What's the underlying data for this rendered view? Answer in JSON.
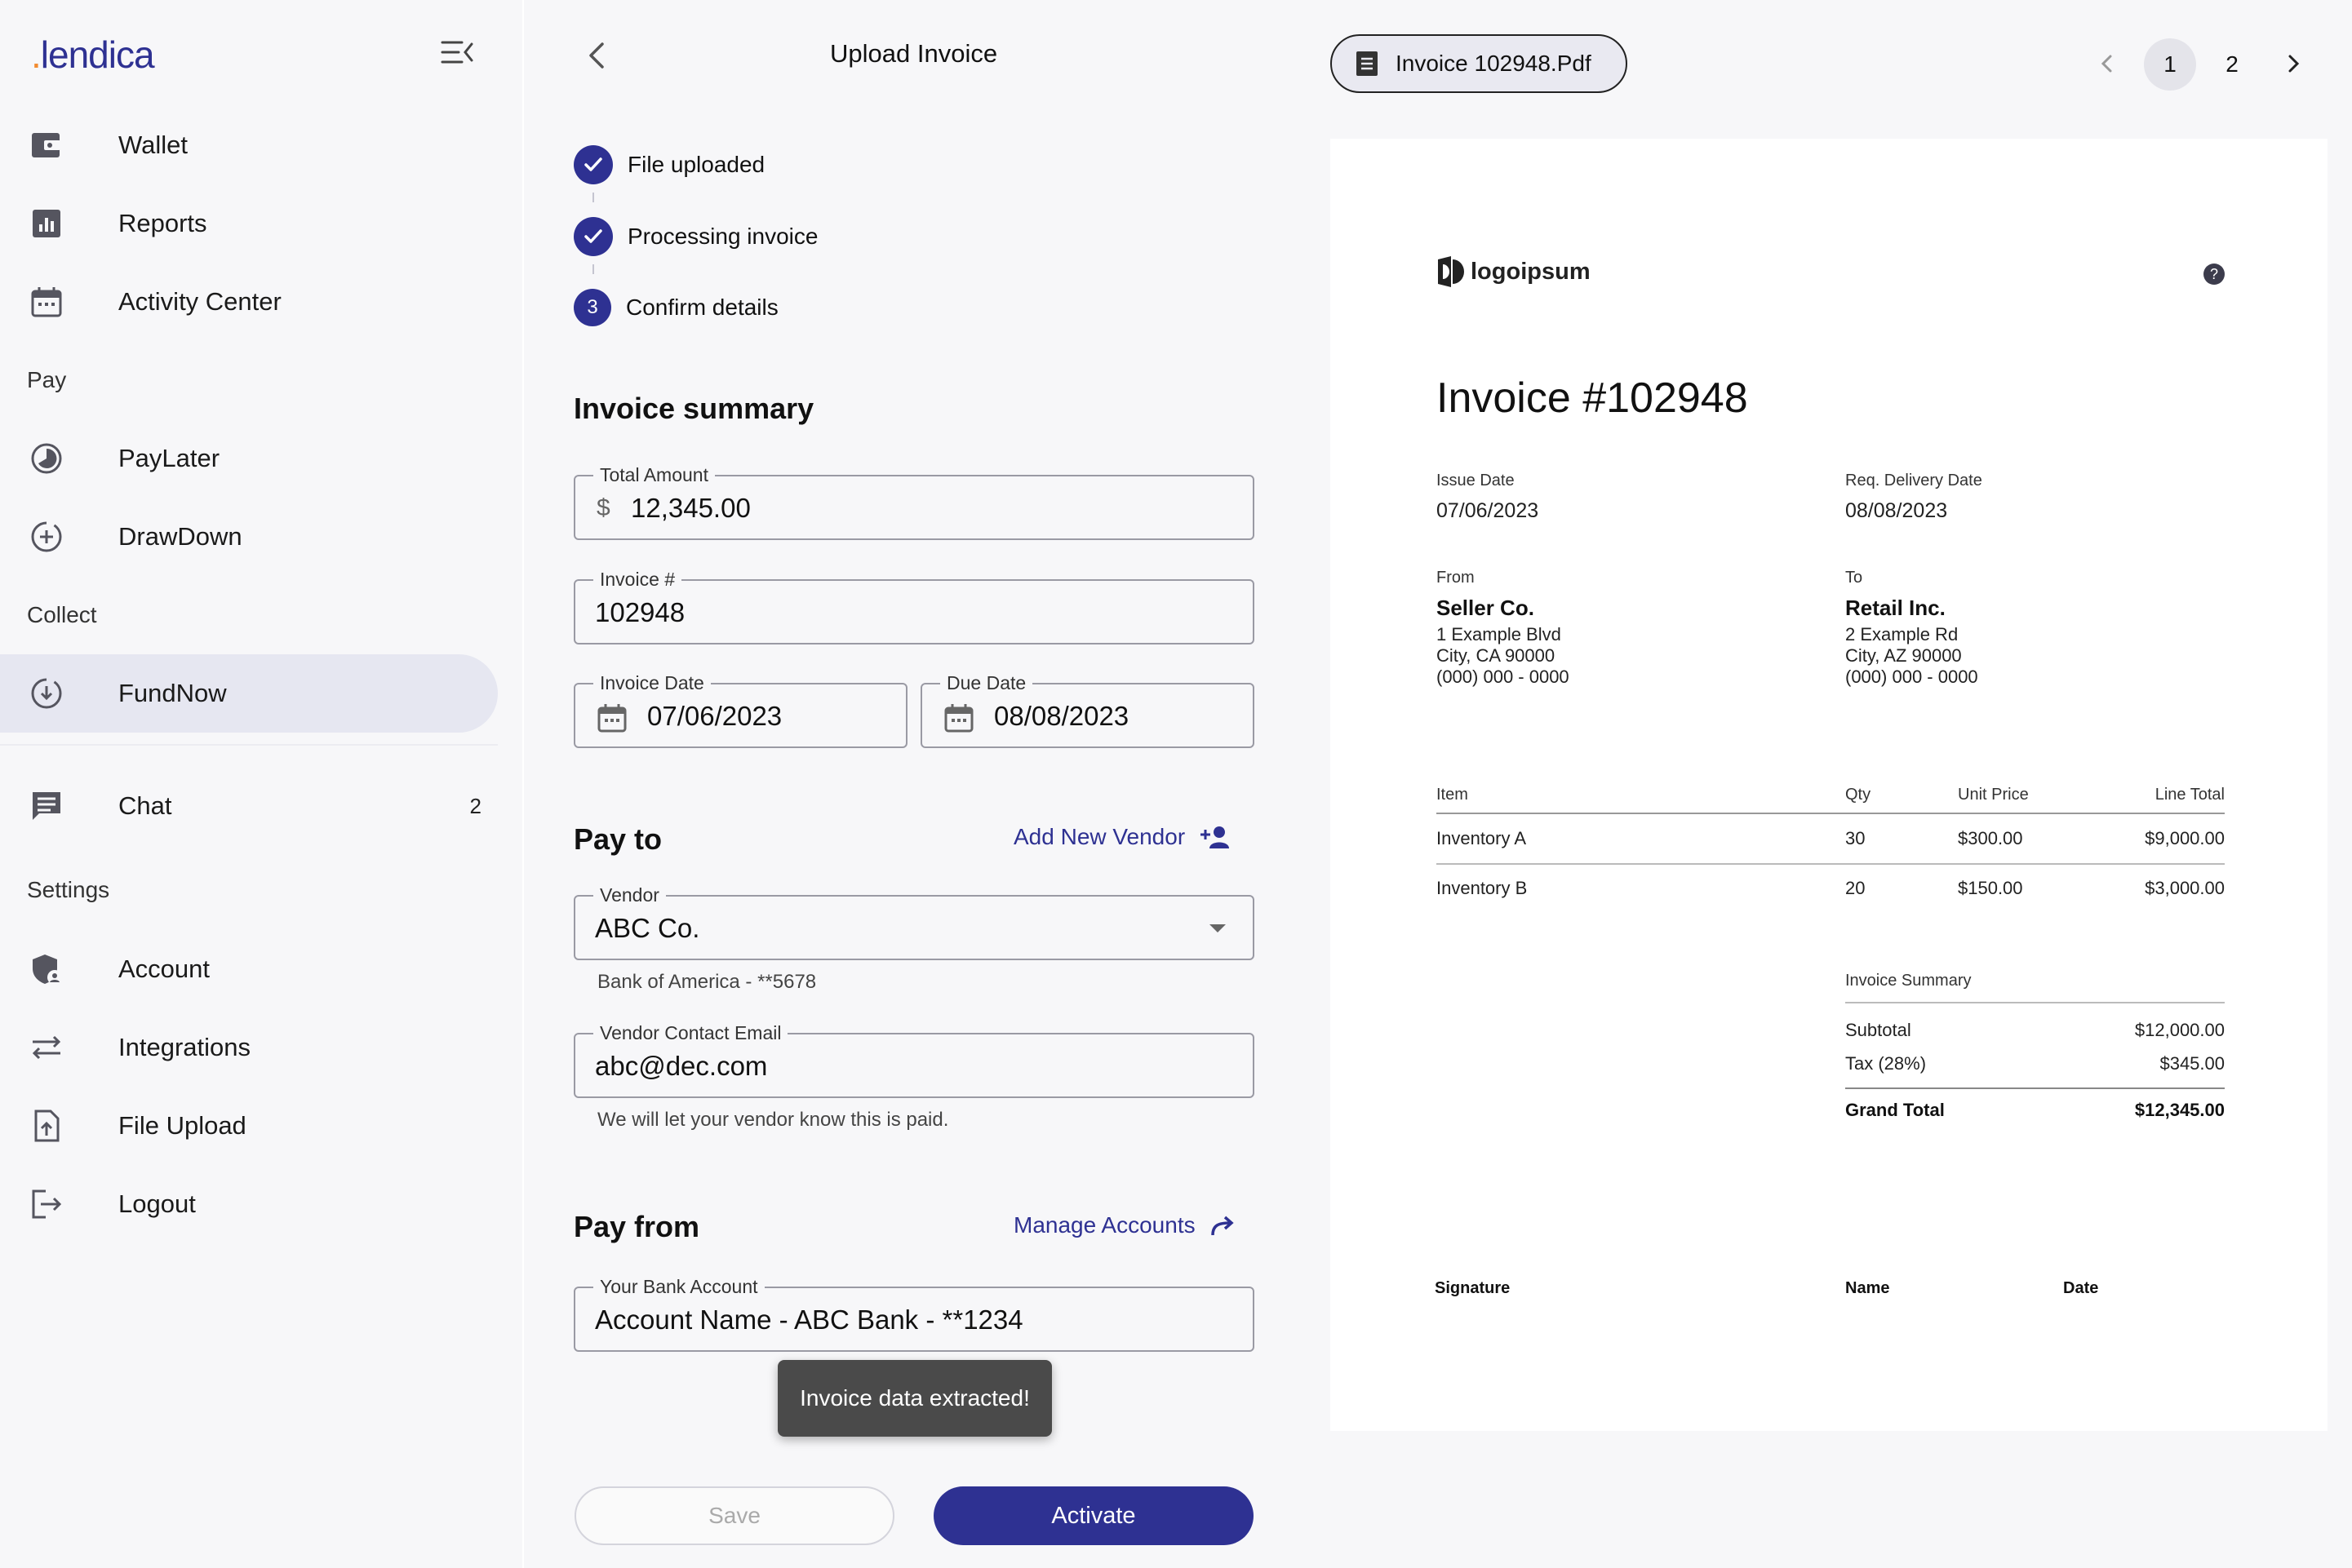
{
  "sidebar": {
    "logo_text": "lendica",
    "items": {
      "wallet": "Wallet",
      "reports": "Reports",
      "activity": "Activity Center",
      "paylater": "PayLater",
      "drawdown": "DrawDown",
      "fundnow": "FundNow",
      "chat": "Chat",
      "chat_badge": "2",
      "account": "Account",
      "integrations": "Integrations",
      "file_upload": "File Upload",
      "logout": "Logout"
    },
    "sections": {
      "pay": "Pay",
      "collect": "Collect",
      "settings": "Settings"
    }
  },
  "form": {
    "title": "Upload Invoice",
    "steps": [
      {
        "label": "File uploaded"
      },
      {
        "label": "Processing invoice"
      },
      {
        "label": "Confirm details",
        "number": "3"
      }
    ],
    "invoice_summary": {
      "heading": "Invoice summary",
      "total_amount_label": "Total Amount",
      "currency_symbol": "$",
      "total_amount": "12,345.00",
      "invoice_no_label": "Invoice #",
      "invoice_no": "102948",
      "invoice_date_label": "Invoice Date",
      "invoice_date": "07/06/2023",
      "due_date_label": "Due Date",
      "due_date": "08/08/2023"
    },
    "pay_to": {
      "heading": "Pay to",
      "add_vendor": "Add New Vendor",
      "vendor_label": "Vendor",
      "vendor": "ABC Co.",
      "vendor_bank": "Bank of America - **5678",
      "email_label": "Vendor Contact Email",
      "email": "abc@dec.com",
      "email_helper": "We will let your vendor know this is paid."
    },
    "pay_from": {
      "heading": "Pay from",
      "manage": "Manage Accounts",
      "account_label": "Your Bank Account",
      "account": "Account Name - ABC Bank - **1234"
    },
    "toast": "Invoice data extracted!",
    "save": "Save",
    "activate": "Activate"
  },
  "preview": {
    "file_name": "Invoice 102948.Pdf",
    "pages": [
      "1",
      "2"
    ],
    "current_page": "1",
    "invoice": {
      "logo": "logoipsum",
      "help": "?",
      "title": "Invoice #102948",
      "issue_date_label": "Issue Date",
      "issue_date": "07/06/2023",
      "delivery_label": "Req. Delivery Date",
      "delivery_date": "08/08/2023",
      "from_label": "From",
      "from_name": "Seller Co.",
      "from_addr1": "1 Example Blvd",
      "from_addr2": "City, CA 90000",
      "from_phone": "(000) 000 - 0000",
      "to_label": "To",
      "to_name": "Retail Inc.",
      "to_addr1": "2 Example Rd",
      "to_addr2": "City, AZ 90000",
      "to_phone": "(000) 000 - 0000",
      "table_headers": {
        "item": "Item",
        "qty": "Qty",
        "unit": "Unit Price",
        "total": "Line Total"
      },
      "rows": [
        {
          "item": "Inventory A",
          "qty": "30",
          "unit": "$300.00",
          "total": "$9,000.00"
        },
        {
          "item": "Inventory B",
          "qty": "20",
          "unit": "$150.00",
          "total": "$3,000.00"
        }
      ],
      "summary_label": "Invoice Summary",
      "subtotal_label": "Subtotal",
      "subtotal": "$12,000.00",
      "tax_label": "Tax (28%)",
      "tax": "$345.00",
      "grand_label": "Grand Total",
      "grand": "$12,345.00",
      "signature": "Signature",
      "name": "Name",
      "date": "Date"
    }
  },
  "colors": {
    "accent": "#2e3192",
    "logo_dot": "#f28b30"
  }
}
